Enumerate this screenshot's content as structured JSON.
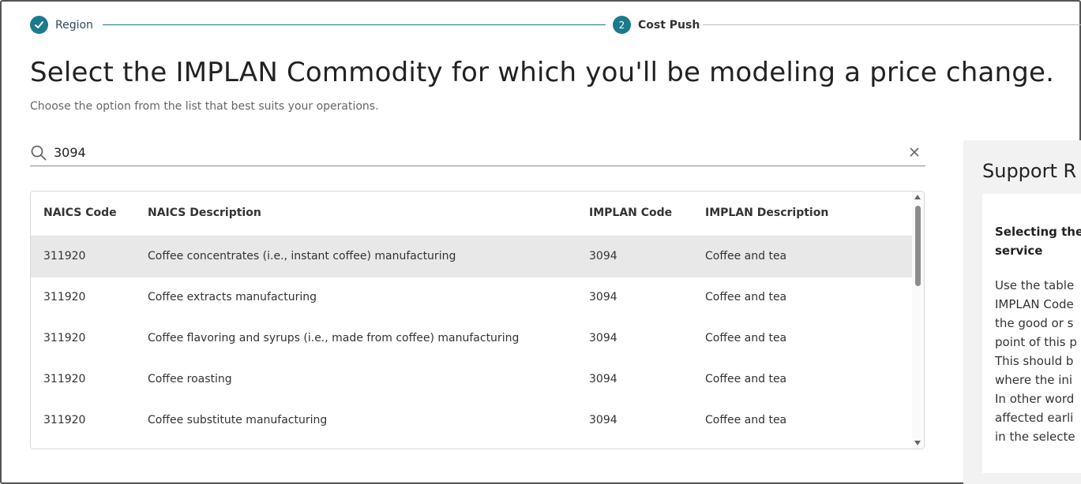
{
  "stepper": {
    "steps": [
      {
        "label": "Region",
        "marker": "check-icon",
        "state": "complete"
      },
      {
        "label": "Cost Push",
        "marker": "2",
        "state": "active"
      }
    ],
    "accent_color": "#1b7a8c"
  },
  "page": {
    "title": "Select the IMPLAN Commodity for which you'll be modeling a price change.",
    "subtitle": "Choose the option from the list that best suits your operations."
  },
  "search": {
    "value": "3094",
    "placeholder": ""
  },
  "table": {
    "columns": [
      "NAICS Code",
      "NAICS Description",
      "IMPLAN Code",
      "IMPLAN Description"
    ],
    "rows": [
      {
        "naics_code": "311920",
        "naics_description": "Coffee concentrates (i.e., instant coffee) manufacturing",
        "implan_code": "3094",
        "implan_description": "Coffee and tea",
        "selected": true
      },
      {
        "naics_code": "311920",
        "naics_description": "Coffee extracts manufacturing",
        "implan_code": "3094",
        "implan_description": "Coffee and tea",
        "selected": false
      },
      {
        "naics_code": "311920",
        "naics_description": "Coffee flavoring and syrups (i.e., made from coffee) manufacturing",
        "implan_code": "3094",
        "implan_description": "Coffee and tea",
        "selected": false
      },
      {
        "naics_code": "311920",
        "naics_description": "Coffee roasting",
        "implan_code": "3094",
        "implan_description": "Coffee and tea",
        "selected": false
      },
      {
        "naics_code": "311920",
        "naics_description": "Coffee substitute manufacturing",
        "implan_code": "3094",
        "implan_description": "Coffee and tea",
        "selected": false
      }
    ]
  },
  "support": {
    "title": "Support R",
    "heading_lines": [
      "Selecting the",
      "service"
    ],
    "body_lines": [
      "Use the table",
      "IMPLAN Code",
      "the good or s",
      "point of this p",
      "This should b",
      "where the ini",
      "In other word",
      "affected earli",
      "in the selecte"
    ]
  }
}
